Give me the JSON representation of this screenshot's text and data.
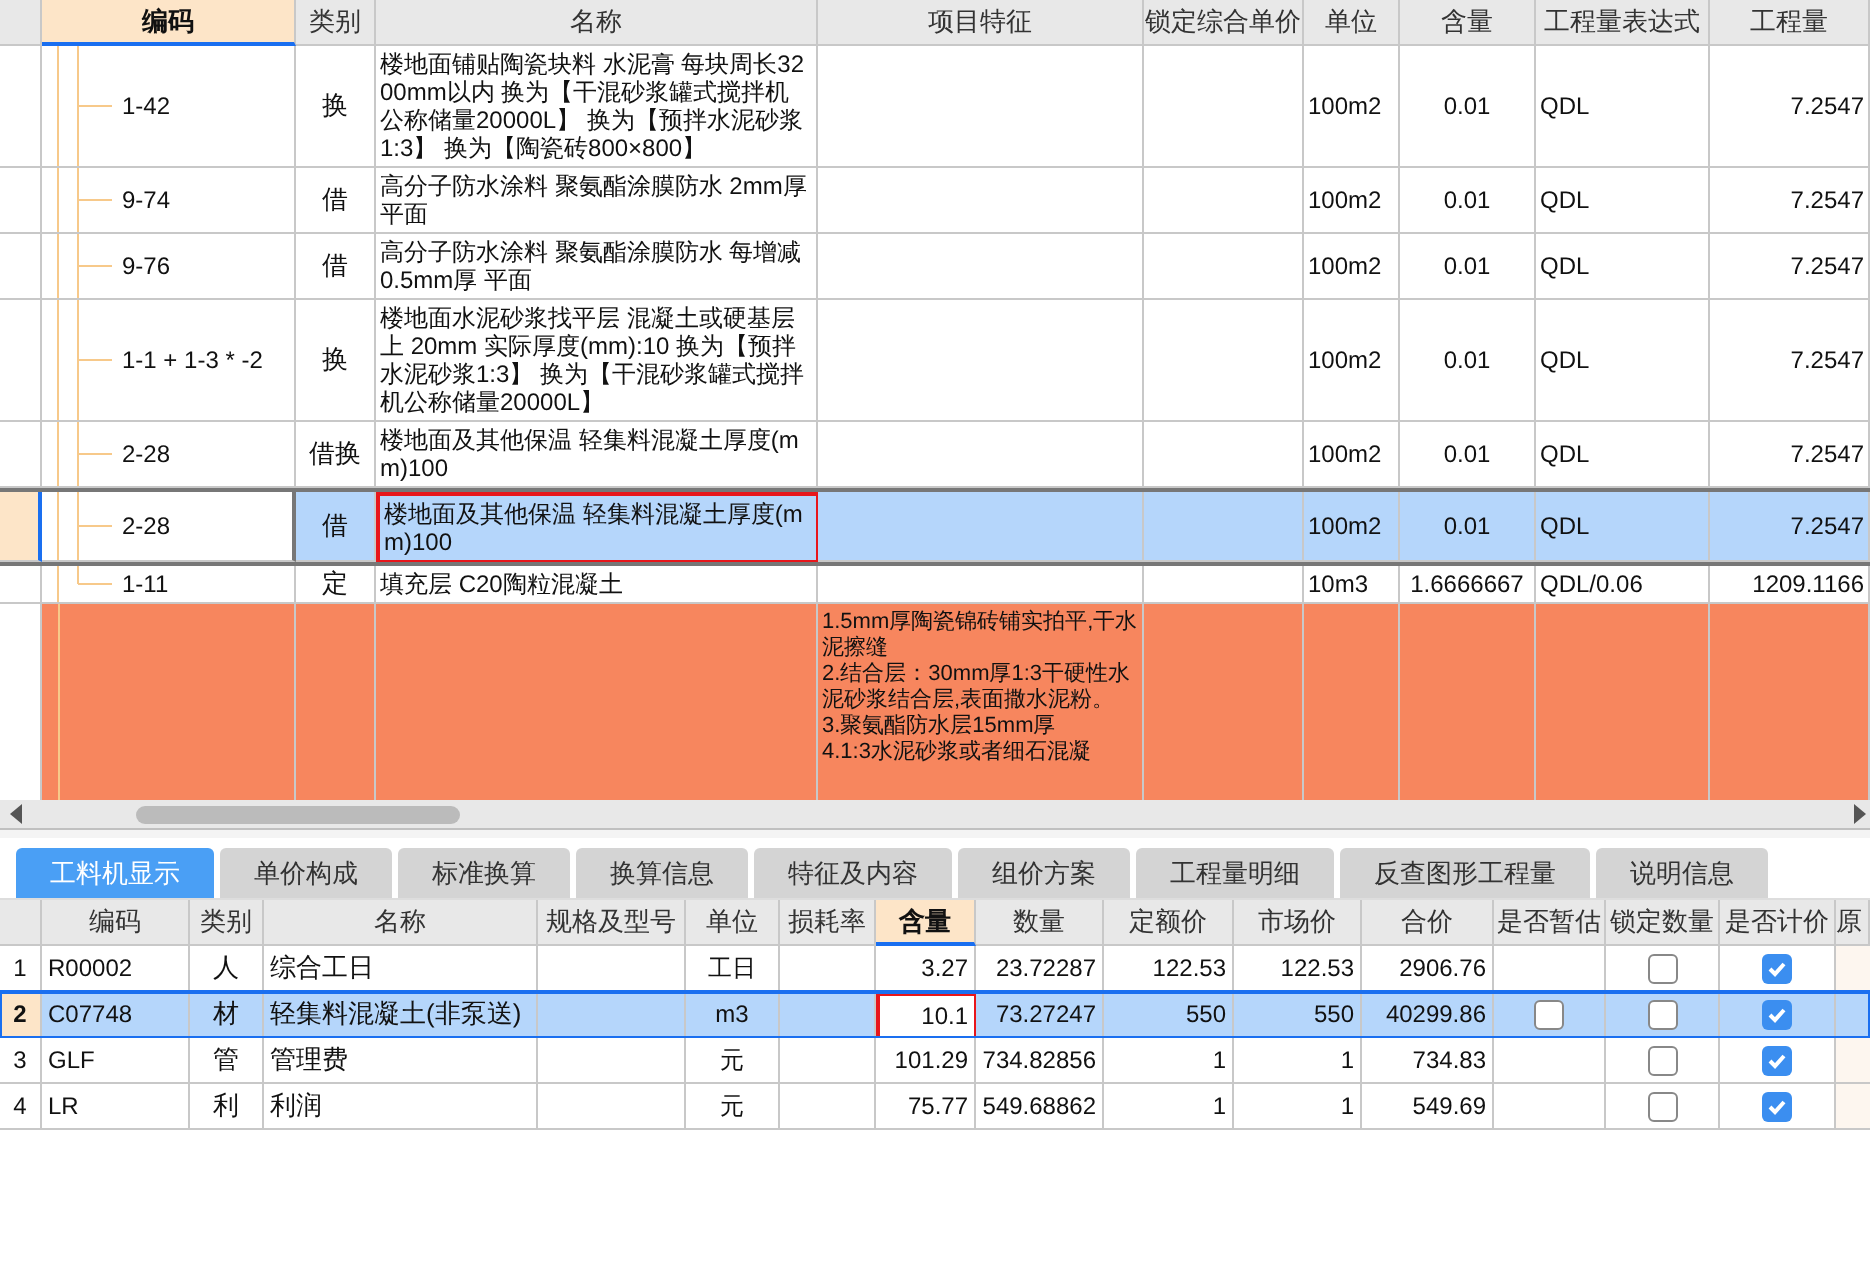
{
  "top_table": {
    "columns": [
      {
        "selected": false
      },
      {
        "label": "编码",
        "selected": true
      },
      {
        "label": "类别",
        "selected": false
      },
      {
        "label": "名称",
        "selected": false
      },
      {
        "label": "项目特征",
        "selected": false
      },
      {
        "label": "锁定综合单价",
        "selected": false
      },
      {
        "label": "单位",
        "selected": false
      },
      {
        "label": "含量",
        "selected": false
      },
      {
        "label": "工程量表达式",
        "selected": false
      },
      {
        "label": "工程量",
        "selected": false
      }
    ],
    "rows": [
      {
        "kind": "subitem",
        "code": "1-42",
        "type": "换",
        "name": "楼地面铺贴陶瓷块料 水泥膏 每块周长3200mm以内  换为【干混砂浆罐式搅拌机公称储量20000L】 换为【预拌水泥砂浆1:3】  换为【陶瓷砖800×800】",
        "unit": "100m2",
        "ratio": "0.01",
        "expression": "QDL",
        "quantity": "7.2547",
        "selected": false,
        "boxed": false
      },
      {
        "kind": "subitem",
        "code": "9-74",
        "type": "借",
        "name": "高分子防水涂料 聚氨酯涂膜防水 2mm厚平面",
        "unit": "100m2",
        "ratio": "0.01",
        "expression": "QDL",
        "quantity": "7.2547",
        "selected": false,
        "boxed": false
      },
      {
        "kind": "subitem",
        "code": "9-76",
        "type": "借",
        "name": "高分子防水涂料 聚氨酯涂膜防水 每增减0.5mm厚 平面",
        "unit": "100m2",
        "ratio": "0.01",
        "expression": "QDL",
        "quantity": "7.2547",
        "selected": false,
        "boxed": false
      },
      {
        "kind": "subitem",
        "code": "1-1 + 1-3 * -2",
        "type": "换",
        "name": "楼地面水泥砂浆找平层 混凝土或硬基层上 20mm  实际厚度(mm):10  换为【预拌水泥砂浆1:3】  换为【干混砂浆罐式搅拌机公称储量20000L】",
        "unit": "100m2",
        "ratio": "0.01",
        "expression": "QDL",
        "quantity": "7.2547",
        "selected": false,
        "boxed": false
      },
      {
        "kind": "subitem",
        "code": "2-28",
        "type": "借换",
        "name": "楼地面及其他保温 轻集料混凝土厚度(mm)100",
        "unit": "100m2",
        "ratio": "0.01",
        "expression": "QDL",
        "quantity": "7.2547",
        "selected": false,
        "boxed": false
      },
      {
        "kind": "subitem",
        "code": "2-28",
        "type": "借",
        "name": "楼地面及其他保温 轻集料混凝土厚度(mm)100",
        "unit": "100m2",
        "ratio": "0.01",
        "expression": "QDL",
        "quantity": "7.2547",
        "selected": true,
        "boxed": true
      },
      {
        "kind": "subitem",
        "code": "1-11",
        "type": "定",
        "name": "填充层 C20陶粒混凝土",
        "unit": "10m3",
        "ratio": "1.6666667",
        "expression": "QDL/0.06",
        "quantity": "1209.1166",
        "selected": false,
        "boxed": false
      },
      {
        "kind": "item",
        "features": [
          "1.5mm厚陶瓷锦砖铺实拍平,干水泥擦缝",
          "2.结合层：30mm厚1:3干硬性水泥砂浆结合层,表面撒水泥粉。",
          "3.聚氨酯防水层15mm厚",
          "4.1:3水泥砂浆或者细石混凝"
        ],
        "selected": false
      }
    ]
  },
  "tabs": [
    {
      "label": "工料机显示",
      "selected": true
    },
    {
      "label": "单价构成",
      "selected": false
    },
    {
      "label": "标准换算",
      "selected": false
    },
    {
      "label": "换算信息",
      "selected": false
    },
    {
      "label": "特征及内容",
      "selected": false
    },
    {
      "label": "组价方案",
      "selected": false
    },
    {
      "label": "工程量明细",
      "selected": false
    },
    {
      "label": "反查图形工程量",
      "selected": false
    },
    {
      "label": "说明信息",
      "selected": false
    }
  ],
  "bottom_table": {
    "columns": [
      {
        "selected": false
      },
      {
        "label": "编码",
        "selected": false
      },
      {
        "label": "类别",
        "selected": false
      },
      {
        "label": "名称",
        "selected": false
      },
      {
        "label": "规格及型号",
        "selected": false
      },
      {
        "label": "单位",
        "selected": false
      },
      {
        "label": "损耗率",
        "selected": false
      },
      {
        "label": "含量",
        "selected": true
      },
      {
        "label": "数量",
        "selected": false
      },
      {
        "label": "定额价",
        "selected": false
      },
      {
        "label": "市场价",
        "selected": false
      },
      {
        "label": "合价",
        "selected": false
      },
      {
        "label": "是否暂估",
        "selected": false
      },
      {
        "label": "锁定数量",
        "selected": false
      },
      {
        "label": "是否计价",
        "selected": false
      },
      {
        "label": "原",
        "selected": false
      }
    ],
    "rows": [
      {
        "no": "1",
        "code": "R00002",
        "type": "人",
        "name": "综合工日",
        "unit": "工日",
        "ratio": "3.27",
        "qty": "23.72287",
        "base_price": "122.53",
        "market_price": "122.53",
        "total": "2906.76",
        "lock_qty": false,
        "priced": true,
        "selected": false,
        "boxed": false
      },
      {
        "no": "2",
        "code": "C07748",
        "type": "材",
        "name": "轻集料混凝土(非泵送)",
        "unit": "m3",
        "ratio": "10.1",
        "qty": "73.27247",
        "base_price": "550",
        "market_price": "550",
        "total": "40299.86",
        "provisional": false,
        "lock_qty": false,
        "priced": true,
        "selected": true,
        "boxed": true
      },
      {
        "no": "3",
        "code": "GLF",
        "type": "管",
        "name": "管理费",
        "unit": "元",
        "ratio": "101.29",
        "qty": "734.82856",
        "base_price": "1",
        "market_price": "1",
        "total": "734.83",
        "lock_qty": false,
        "priced": true,
        "selected": false,
        "boxed": false
      },
      {
        "no": "4",
        "code": "LR",
        "type": "利",
        "name": "利润",
        "unit": "元",
        "ratio": "75.77",
        "qty": "549.68862",
        "base_price": "1",
        "market_price": "1",
        "total": "549.69",
        "lock_qty": false,
        "priced": true,
        "selected": false,
        "boxed": false
      }
    ]
  }
}
